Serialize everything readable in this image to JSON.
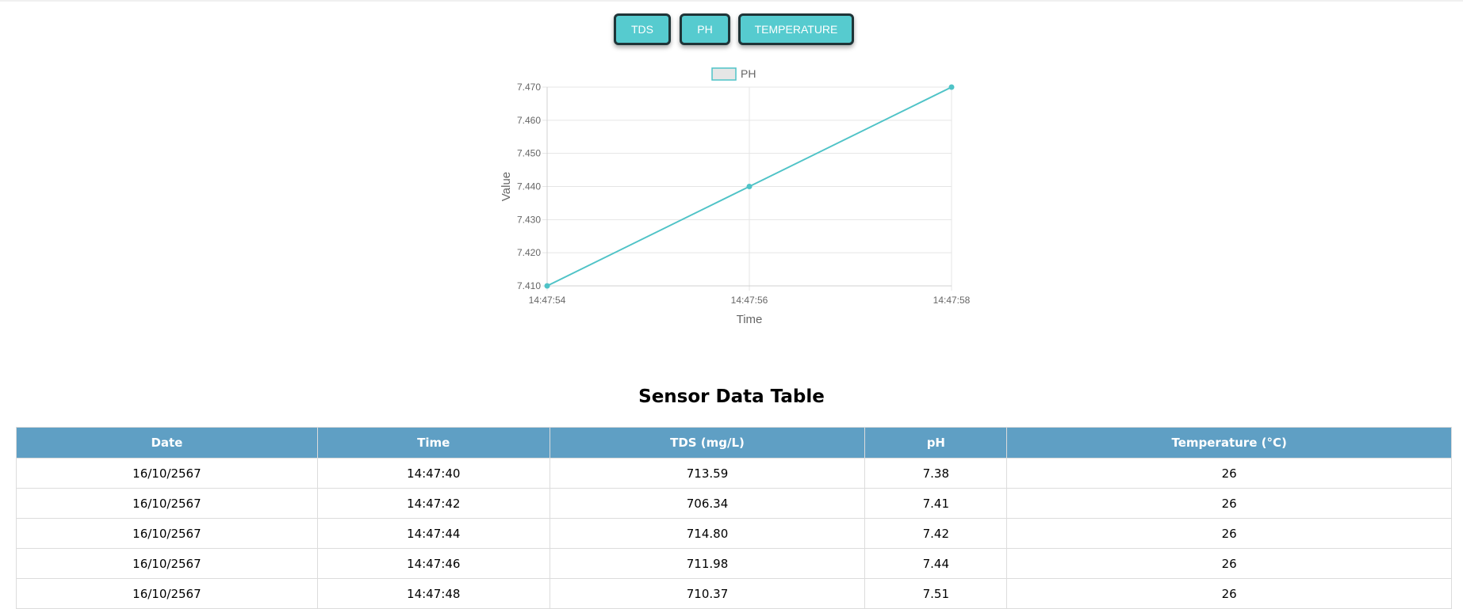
{
  "buttons": [
    {
      "label": "TDS"
    },
    {
      "label": "PH"
    },
    {
      "label": "TEMPERATURE"
    }
  ],
  "chart_data": {
    "type": "line",
    "legend": {
      "label": "PH",
      "placement": "top"
    },
    "xlabel": "Time",
    "ylabel": "Value",
    "x": [
      "14:47:54",
      "14:47:56",
      "14:47:58"
    ],
    "series": [
      {
        "name": "PH",
        "values": [
          7.41,
          7.44,
          7.47
        ]
      }
    ],
    "ylim": [
      7.41,
      7.47
    ],
    "yticks": [
      "7.470",
      "7.460",
      "7.450",
      "7.440",
      "7.430",
      "7.420",
      "7.410"
    ],
    "grid": true,
    "colors": {
      "line": "#4fc3c7",
      "legend_fill": "#e6e6e6",
      "grid": "#e5e5e5",
      "text": "#666666"
    }
  },
  "table": {
    "title": "Sensor Data Table",
    "headers": [
      "Date",
      "Time",
      "TDS (mg/L)",
      "pH",
      "Temperature (°C)"
    ],
    "rows": [
      [
        "16/10/2567",
        "14:47:40",
        "713.59",
        "7.38",
        "26"
      ],
      [
        "16/10/2567",
        "14:47:42",
        "706.34",
        "7.41",
        "26"
      ],
      [
        "16/10/2567",
        "14:47:44",
        "714.80",
        "7.42",
        "26"
      ],
      [
        "16/10/2567",
        "14:47:46",
        "711.98",
        "7.44",
        "26"
      ],
      [
        "16/10/2567",
        "14:47:48",
        "710.37",
        "7.51",
        "26"
      ]
    ]
  }
}
